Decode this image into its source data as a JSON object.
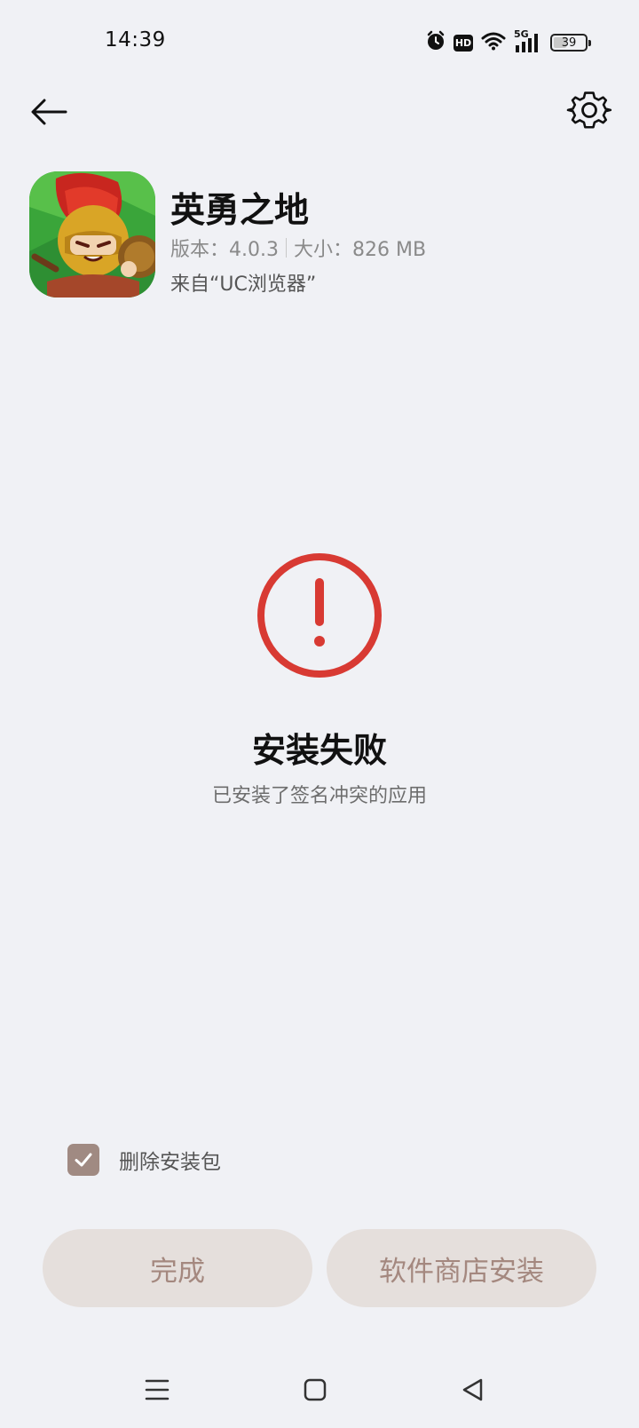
{
  "status_bar": {
    "time": "14:39",
    "hd_label": "HD",
    "network_label": "5G",
    "battery_level": "39",
    "icons": [
      "alarm-icon",
      "hd-icon",
      "wifi-icon",
      "signal-5g-icon",
      "battery-icon"
    ]
  },
  "top_bar": {
    "back_icon": "arrow-left-icon",
    "settings_icon": "gear-icon"
  },
  "app": {
    "name": "英勇之地",
    "version": "版本：4.0.3",
    "size": "大小：826 MB",
    "source": "来自“UC浏览器”"
  },
  "result": {
    "icon": "error-circle-icon",
    "title": "安装失败",
    "description": "已安装了签名冲突的应用"
  },
  "options": {
    "delete_package_label": "删除安装包",
    "delete_package_checked": true
  },
  "buttons": {
    "done": "完成",
    "store_install": "软件商店安装"
  },
  "nav_bar": {
    "icons": [
      "menu-icon",
      "home-icon",
      "back-triangle-icon"
    ]
  },
  "colors": {
    "background": "#f0f1f5",
    "error_red": "#d83a33",
    "button_bg": "#e5dfdc",
    "button_text": "#a4887f",
    "checkbox": "#a08a82"
  }
}
